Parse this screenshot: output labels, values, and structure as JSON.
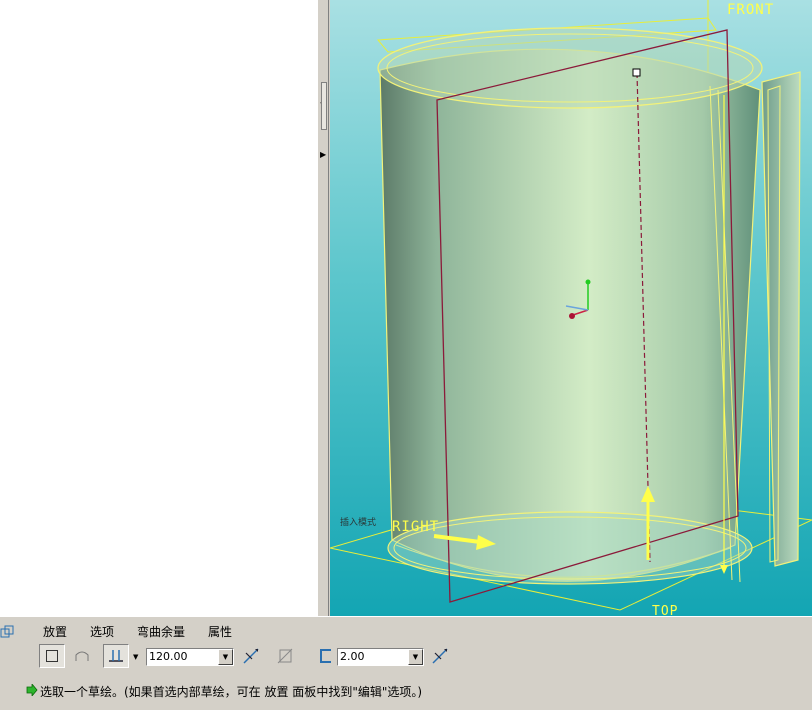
{
  "viewport": {
    "datum_front": "FRONT",
    "datum_right": "RIGHT",
    "datum_top": "TOP",
    "tag_text": "插入模式"
  },
  "dashboard": {
    "tabs": [
      "放置",
      "选项",
      "弯曲余量",
      "属性"
    ],
    "thickness_angle_value": "120.00",
    "bend_radius_value": "2.00",
    "status_message": "选取一个草绘。(如果首选内部草绘，可在 放置 面板中找到\"编辑\"选项。)"
  },
  "colors": {
    "viewport_top": "#a9e0e3",
    "viewport_bottom": "#13a5b3",
    "datum_yellow": "#ffff4a",
    "edge_maroon": "#8b1a3a"
  }
}
